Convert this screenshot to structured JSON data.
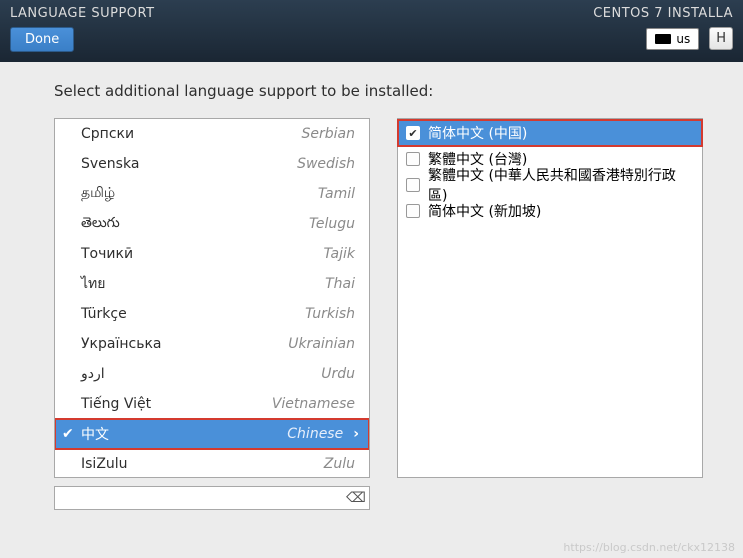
{
  "header": {
    "title": "LANGUAGE SUPPORT",
    "done_label": "Done",
    "installer_label": "CENTOS 7 INSTALLA",
    "keyboard_layout": "us",
    "help_label": "H"
  },
  "instruction": "Select additional language support to be installed:",
  "languages": [
    {
      "native": "Српски",
      "english": "Serbian",
      "selected": false
    },
    {
      "native": "Svenska",
      "english": "Swedish",
      "selected": false
    },
    {
      "native": "தமிழ்",
      "english": "Tamil",
      "selected": false
    },
    {
      "native": "తెలుగు",
      "english": "Telugu",
      "selected": false
    },
    {
      "native": "Точикӣ",
      "english": "Tajik",
      "selected": false
    },
    {
      "native": "ไทย",
      "english": "Thai",
      "selected": false
    },
    {
      "native": "Türkçe",
      "english": "Turkish",
      "selected": false
    },
    {
      "native": "Українська",
      "english": "Ukrainian",
      "selected": false
    },
    {
      "native": "اردو",
      "english": "Urdu",
      "selected": false
    },
    {
      "native": "Tiếng Việt",
      "english": "Vietnamese",
      "selected": false
    },
    {
      "native": "中文",
      "english": "Chinese",
      "selected": true
    },
    {
      "native": "IsiZulu",
      "english": "Zulu",
      "selected": false
    }
  ],
  "variants": [
    {
      "label": "简体中文 (中国)",
      "checked": true,
      "highlight": true
    },
    {
      "label": "繁體中文 (台灣)",
      "checked": false,
      "highlight": false
    },
    {
      "label": "繁體中文 (中華人民共和國香港特別行政區)",
      "checked": false,
      "highlight": false
    },
    {
      "label": "简体中文 (新加坡)",
      "checked": false,
      "highlight": false
    }
  ],
  "search": {
    "value": "",
    "placeholder": ""
  },
  "watermark": "https://blog.csdn.net/ckx12138"
}
